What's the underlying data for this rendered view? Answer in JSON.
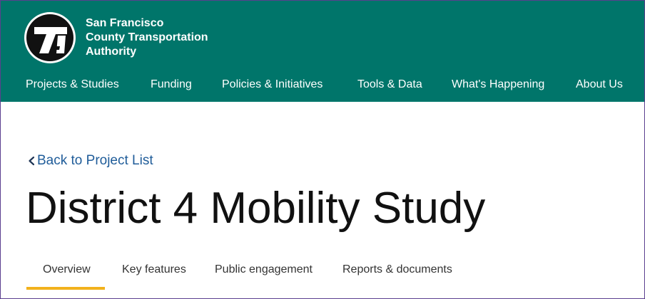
{
  "colors": {
    "header_bg": "#00756a",
    "link": "#1f5c99",
    "active_tab_underline": "#f2b21c",
    "frame_border": "#5b3f8f"
  },
  "org": {
    "logo_icon": "sfcta-logo-icon",
    "name_line1": "San Francisco",
    "name_line2": "County Transportation",
    "name_line3": "Authority"
  },
  "nav": {
    "items": [
      {
        "label": "Projects & Studies"
      },
      {
        "label": "Funding"
      },
      {
        "label": "Policies & Initiatives"
      },
      {
        "label": "Tools & Data"
      },
      {
        "label": "What's Happening"
      },
      {
        "label": "About Us"
      }
    ]
  },
  "back_link": {
    "icon": "chevron-left-icon",
    "label": "Back to Project List"
  },
  "page": {
    "title": "District 4 Mobility Study"
  },
  "tabs": {
    "active": "Overview",
    "items": [
      {
        "label": "Overview"
      },
      {
        "label": "Key features"
      },
      {
        "label": "Public engagement"
      },
      {
        "label": "Reports & documents"
      }
    ]
  }
}
